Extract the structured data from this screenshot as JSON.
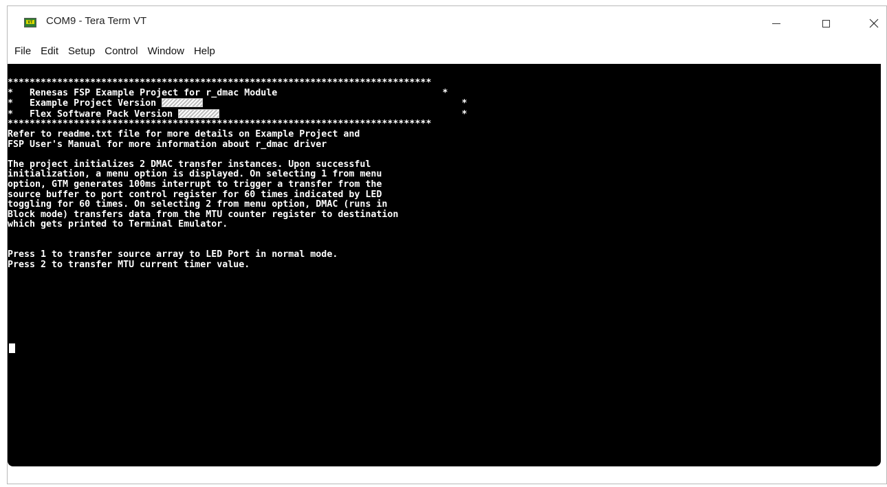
{
  "window": {
    "title": "COM9 - Tera Term VT",
    "app_icon_glyph": "VT",
    "app_icon_name": "tera-term-icon",
    "minimize_icon": "minimize-icon",
    "maximize_icon": "maximize-icon",
    "close_icon": "close-icon"
  },
  "menu": {
    "items": [
      "File",
      "Edit",
      "Setup",
      "Control",
      "Window",
      "Help"
    ]
  },
  "terminal": {
    "background": "#000000",
    "foreground": "#ffffff",
    "banner": {
      "border": "*****************************************************************************",
      "line1": "*   Renesas FSP Example Project for r_dmac Module                              *",
      "line2_prefix": "*   Example Project Version ",
      "line2_suffix": "                                               *",
      "line3_prefix": "*   Flex Software Pack Version ",
      "line3_suffix": "                                            *"
    },
    "intro": [
      "Refer to readme.txt file for more details on Example Project and",
      "FSP User's Manual for more information about r_dmac driver"
    ],
    "description": [
      "The project initializes 2 DMAC transfer instances. Upon successful",
      "initialization, a menu option is displayed. On selecting 1 from menu",
      "option, GTM generates 100ms interrupt to trigger a transfer from the",
      "source buffer to port control register for 60 times indicated by LED",
      "toggling for 60 times. On selecting 2 from menu option, DMAC (runs in",
      "Block mode) transfers data from the MTU counter register to destination",
      "which gets printed to Terminal Emulator."
    ],
    "options": [
      "Press 1 to transfer source array to LED Port in normal mode.",
      "Press 2 to transfer MTU current timer value."
    ]
  }
}
